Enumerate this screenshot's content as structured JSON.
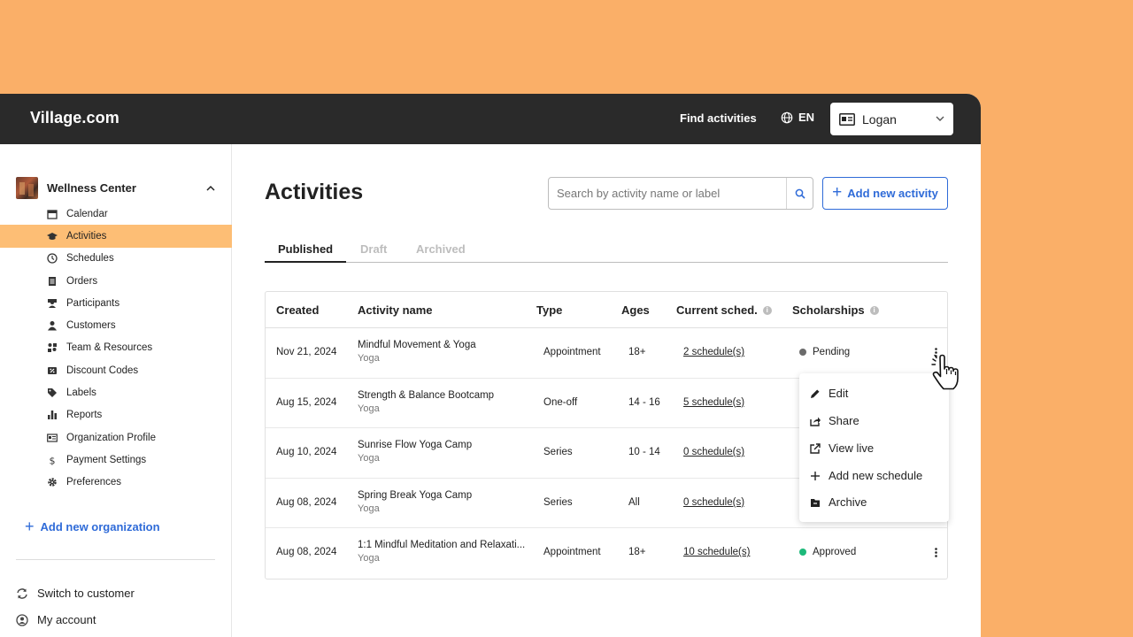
{
  "topbar": {
    "brand": "Village.com",
    "find_activities": "Find activities",
    "language": "EN",
    "user": "Logan"
  },
  "sidebar": {
    "org_name": "Wellness Center",
    "items": [
      {
        "label": "Calendar",
        "icon": "calendar-icon"
      },
      {
        "label": "Activities",
        "icon": "graduation-cap-icon"
      },
      {
        "label": "Schedules",
        "icon": "clock-icon"
      },
      {
        "label": "Orders",
        "icon": "receipt-icon"
      },
      {
        "label": "Participants",
        "icon": "participants-icon"
      },
      {
        "label": "Customers",
        "icon": "person-icon"
      },
      {
        "label": "Team & Resources",
        "icon": "team-icon"
      },
      {
        "label": "Discount Codes",
        "icon": "discount-icon"
      },
      {
        "label": "Labels",
        "icon": "tag-icon"
      },
      {
        "label": "Reports",
        "icon": "bar-chart-icon"
      },
      {
        "label": "Organization Profile",
        "icon": "id-card-icon"
      },
      {
        "label": "Payment Settings",
        "icon": "dollar-icon"
      },
      {
        "label": "Preferences",
        "icon": "gear-icon"
      }
    ],
    "active_item": "Activities",
    "add_org": "Add new organization",
    "switch_customer": "Switch to customer",
    "my_account": "My account"
  },
  "main": {
    "title": "Activities",
    "search_placeholder": "Search by activity name or label",
    "add_activity": "Add new activity",
    "tabs": [
      {
        "label": "Published",
        "active": true
      },
      {
        "label": "Draft",
        "active": false
      },
      {
        "label": "Archived",
        "active": false
      }
    ],
    "table": {
      "headers": {
        "created": "Created",
        "name": "Activity name",
        "type": "Type",
        "ages": "Ages",
        "schedule": "Current sched.",
        "scholarships": "Scholarships"
      },
      "rows": [
        {
          "created": "Nov 21, 2024",
          "name": "Mindful Movement & Yoga",
          "category": "Yoga",
          "type": "Appointment",
          "ages": "18+",
          "schedule": "2 schedule(s)",
          "scholarship": "Pending",
          "status_color": "#6B6B6B"
        },
        {
          "created": "Aug 15, 2024",
          "name": "Strength & Balance Bootcamp",
          "category": "Yoga",
          "type": "One-off",
          "ages": "14 - 16",
          "schedule": "5 schedule(s)",
          "scholarship": "",
          "status_color": "#1DB97A"
        },
        {
          "created": "Aug 10, 2024",
          "name": "Sunrise Flow Yoga Camp",
          "category": "Yoga",
          "type": "Series",
          "ages": "10 - 14",
          "schedule": "0 schedule(s)",
          "scholarship": "",
          "status_color": "#1DB97A"
        },
        {
          "created": "Aug 08, 2024",
          "name": "Spring Break Yoga Camp",
          "category": "Yoga",
          "type": "Series",
          "ages": "All",
          "schedule": "0 schedule(s)",
          "scholarship": "",
          "status_color": "#1DB97A"
        },
        {
          "created": "Aug 08, 2024",
          "name": "1:1 Mindful Meditation and Relaxati...",
          "category": "Yoga",
          "type": "Appointment",
          "ages": "18+",
          "schedule": "10 schedule(s)",
          "scholarship": "Approved",
          "status_color": "#1DB97A"
        }
      ]
    }
  },
  "context_menu": {
    "items": [
      {
        "label": "Edit",
        "icon": "pencil-icon"
      },
      {
        "label": "Share",
        "icon": "share-icon"
      },
      {
        "label": "View live",
        "icon": "external-link-icon"
      },
      {
        "label": "Add new schedule",
        "icon": "plus-icon"
      },
      {
        "label": "Archive",
        "icon": "archive-folder-icon"
      }
    ]
  },
  "colors": {
    "background": "#FAAF68",
    "topbar": "#2A2A2A",
    "active_nav": "#FDBE75",
    "accent_blue": "#2F6BD8"
  }
}
